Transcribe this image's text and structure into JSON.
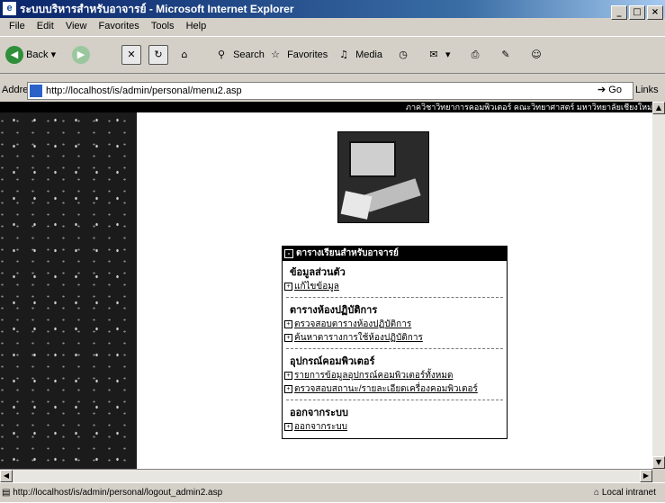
{
  "window": {
    "title": "ระบบบริหารสำหรับอาจารย์ - Microsoft Internet Explorer",
    "controls": {
      "minimize": "_",
      "maximize": "□",
      "close": "×"
    }
  },
  "menubar": {
    "items": [
      "File",
      "Edit",
      "View",
      "Favorites",
      "Tools",
      "Help"
    ]
  },
  "toolbar": {
    "back_label": "Back",
    "search_label": "Search",
    "favorites_label": "Favorites",
    "media_label": "Media"
  },
  "address": {
    "label": "Address",
    "url": "http://localhost/is/admin/personal/menu2.asp",
    "go_label": "Go",
    "links_label": "Links"
  },
  "page": {
    "top_strip_text": "ภาควิชาวิทยาการคอมพิวเตอร์ คณะวิทยาศาสตร์ มหาวิทยาลัยเชียงใหม่",
    "menu": {
      "header": "ตารางเรียนสำหรับอาจารย์",
      "sections": [
        {
          "title": "ข้อมูลส่วนตัว",
          "items": [
            "แก้ไขข้อมูล"
          ]
        },
        {
          "title": "ตารางห้องปฏิบัติการ",
          "items": [
            "ตรวจสอบตารางห้องปฏิบัติการ",
            "ค้นหาตารางการใช้ห้องปฏิบัติการ"
          ]
        },
        {
          "title": "อุปกรณ์คอมพิวเตอร์",
          "items": [
            "รายการข้อมูลอุปกรณ์คอมพิวเตอร์ทั้งหมด",
            "ตรวจสอบสถานะ/รายละเอียดเครื่องคอมพิวเตอร์"
          ]
        },
        {
          "title": "ออกจากระบบ",
          "items": [
            "ออกจากระบบ"
          ]
        }
      ]
    }
  },
  "statusbar": {
    "link_text": "http://localhost/is/admin/personal/logout_admin2.asp",
    "zone": "Local intranet"
  }
}
